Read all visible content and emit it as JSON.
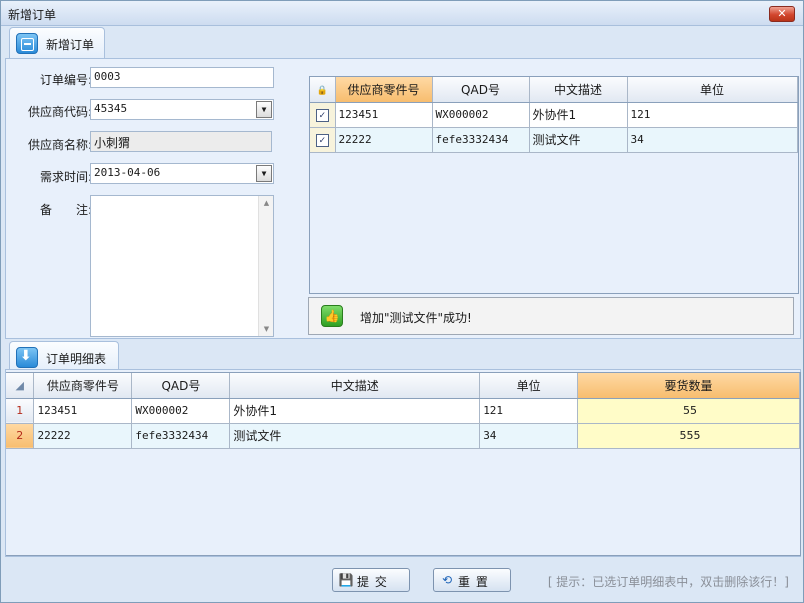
{
  "window": {
    "title": "新增订单",
    "close_glyph": "✕"
  },
  "tabs": {
    "new_order": "新增订单",
    "order_detail": "订单明细表"
  },
  "form": {
    "order_no_label": "订单编号:",
    "order_no_value": "0003",
    "supplier_code_label": "供应商代码:",
    "supplier_code_value": "45345",
    "supplier_name_label": "供应商名称:",
    "supplier_name_value": "小刺猬",
    "required_time_label": "需求时间:",
    "required_time_value": "2013-04-06",
    "remark_label": "备　　注:"
  },
  "parts_grid": {
    "columns": [
      "供应商零件号",
      "QAD号",
      "中文描述",
      "单位"
    ],
    "rows": [
      {
        "checked": true,
        "part_no": "123451",
        "qad": "WX000002",
        "desc": "外协件1",
        "unit": "121"
      },
      {
        "checked": true,
        "part_no": "22222",
        "qad": "fefe3332434",
        "desc": "测试文件",
        "unit": "34"
      }
    ]
  },
  "notice": {
    "text": "增加\"测试文件\"成功!"
  },
  "detail_grid": {
    "columns": [
      "供应商零件号",
      "QAD号",
      "中文描述",
      "单位",
      "要货数量"
    ],
    "rows": [
      {
        "num": "1",
        "part_no": "123451",
        "qad": "WX000002",
        "desc": "外协件1",
        "unit": "121",
        "qty": "55"
      },
      {
        "num": "2",
        "part_no": "22222",
        "qad": "fefe3332434",
        "desc": "测试文件",
        "unit": "34",
        "qty": "555"
      }
    ]
  },
  "buttons": {
    "submit": "提  交",
    "reset": "重  置"
  },
  "hint": "[ 提示：已选订单明细表中，双击删除该行！]"
}
